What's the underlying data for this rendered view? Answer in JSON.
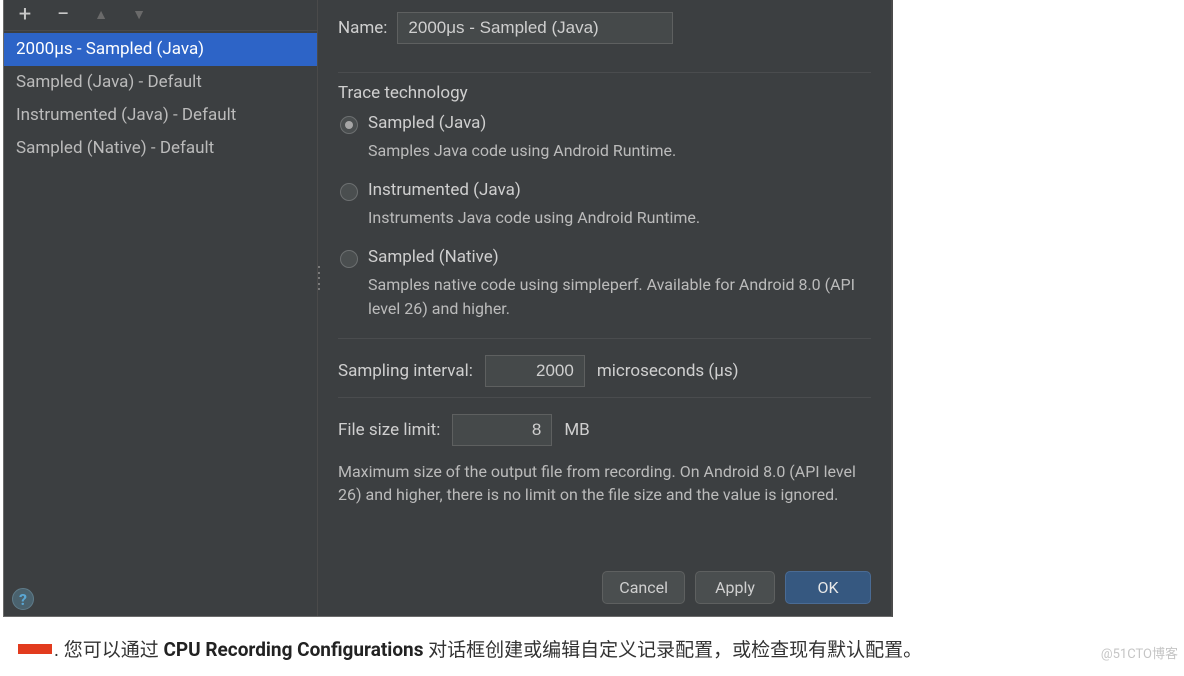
{
  "sidebar": {
    "items": [
      {
        "label": "2000μs - Sampled (Java)",
        "selected": true
      },
      {
        "label": "Sampled (Java) - Default",
        "selected": false
      },
      {
        "label": "Instrumented (Java) - Default",
        "selected": false
      },
      {
        "label": "Sampled (Native) - Default",
        "selected": false
      }
    ]
  },
  "name": {
    "label": "Name:",
    "value": "2000μs - Sampled (Java)"
  },
  "trace": {
    "title": "Trace technology",
    "options": [
      {
        "label": "Sampled (Java)",
        "desc": "Samples Java code using Android Runtime.",
        "selected": true
      },
      {
        "label": "Instrumented (Java)",
        "desc": "Instruments Java code using Android Runtime.",
        "selected": false
      },
      {
        "label": "Sampled (Native)",
        "desc": "Samples native code using simpleperf. Available for Android 8.0 (API level 26) and higher.",
        "selected": false
      }
    ]
  },
  "sampling": {
    "label": "Sampling interval:",
    "value": "2000",
    "unit": "microseconds (μs)"
  },
  "filesize": {
    "label": "File size limit:",
    "value": "8",
    "unit": "MB",
    "hint": "Maximum size of the output file from recording. On Android 8.0 (API level 26) and higher, there is no limit on the file size and the value is ignored."
  },
  "buttons": {
    "cancel": "Cancel",
    "apply": "Apply",
    "ok": "OK"
  },
  "caption": {
    "prefix": ". 您可以通过 ",
    "bold": "CPU Recording Configurations",
    "suffix": " 对话框创建或编辑自定义记录配置，或检查现有默认配置。"
  },
  "watermark": "@51CTO博客"
}
